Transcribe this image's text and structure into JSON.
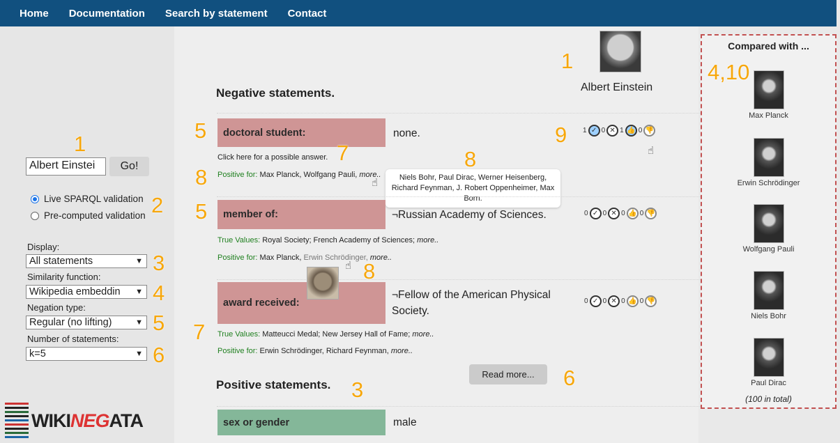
{
  "nav": {
    "items": [
      "Home",
      "Documentation",
      "Search by statement",
      "Contact"
    ]
  },
  "annotations": [
    "1",
    "1",
    "2",
    "3",
    "4",
    "5",
    "6",
    "5",
    "7",
    "8",
    "8",
    "9",
    "5",
    "8",
    "7",
    "6",
    "3",
    "4,10"
  ],
  "left": {
    "entity_input": "Albert Einstei",
    "go_button": "Go!",
    "radio_live": "Live SPARQL validation",
    "radio_precomputed": "Pre-computed validation",
    "display_label": "Display:",
    "display_value": "All statements",
    "similarity_label": "Similarity function:",
    "similarity_value": "Wikipedia embeddin",
    "negation_label": "Negation type:",
    "negation_value": "Regular (no lifting)",
    "count_label": "Number of statements:",
    "count_value": "k=5",
    "logo_pre": "WIKI",
    "logo_neg": "NEG",
    "logo_post": "ATA"
  },
  "main": {
    "negative_heading": "Negative statements.",
    "positive_heading": "Positive statements.",
    "entity_name": "Albert Einstein",
    "read_more": "Read more...",
    "tooltip": "Niels Bohr, Paul Dirac, Werner Heisenberg, Richard Feynman, J. Robert Oppenheimer, Max Born.",
    "negative_rows": [
      {
        "property": "doctoral student:",
        "value": "none.",
        "answer_prompt": "Click here for a possible answer.",
        "positive_label": "Positive for:",
        "positive_values": " Max Planck, Wolfgang Pauli, ",
        "more": "more..",
        "votes": [
          "1",
          "0",
          "1",
          "0"
        ]
      },
      {
        "property": "member of:",
        "value": "¬Russian Academy of Sciences.",
        "true_label": "True Values:",
        "true_values": " Royal Society; French Academy of Sciences; ",
        "positive_label": "Positive for:",
        "positive_values_a": " Max Planck, ",
        "positive_values_b": "Erwin Schrödinger, ",
        "more": "more..",
        "votes": [
          "0",
          "0",
          "0",
          "0"
        ]
      },
      {
        "property": "award received:",
        "value_line1": "¬Fellow of the American Physical",
        "value_line2": "Society.",
        "true_label": "True Values:",
        "true_values": " Matteucci Medal; New Jersey Hall of Fame; ",
        "positive_label": "Positive for:",
        "positive_values": " Erwin Schrödinger, Richard Feynman, ",
        "more": "more..",
        "votes": [
          "0",
          "0",
          "0",
          "0"
        ]
      }
    ],
    "positive_rows": [
      {
        "property": "sex or gender",
        "value": "male"
      }
    ]
  },
  "compare": {
    "title": "Compared with ...",
    "entities": [
      "Max Planck",
      "Erwin Schrödinger",
      "Wolfgang Pauli",
      "Niels Bohr",
      "Paul Dirac"
    ],
    "total": "(100 in total)"
  },
  "colors": {
    "navbar": "#11507f",
    "negative_label": "#cf9595",
    "positive_label": "#84b799",
    "annotation": "#f7a70b",
    "compare_border": "#c25151"
  }
}
